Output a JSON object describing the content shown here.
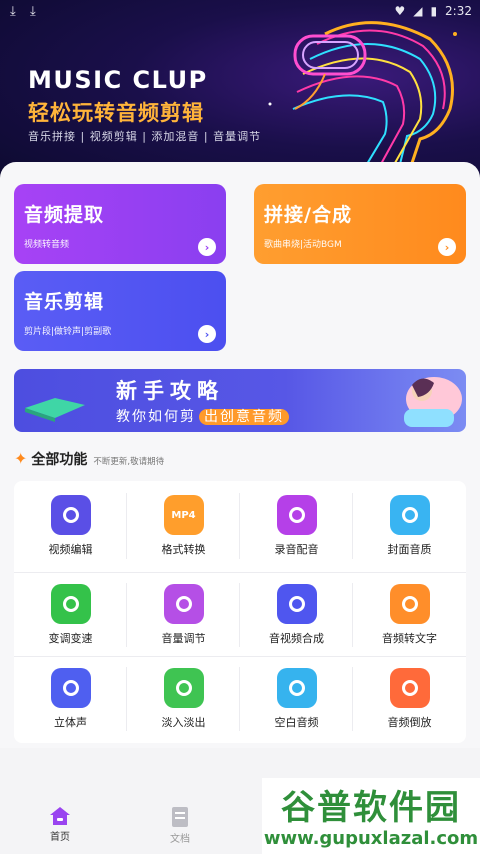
{
  "status": {
    "time": "2:32"
  },
  "banner": {
    "title": "MUSIC CLUP",
    "subtitle": "轻松玩转音频剪辑",
    "tags": "音乐拼接 | 视频剪辑 | 添加混音 | 音量调节"
  },
  "cards": [
    {
      "title": "音频提取",
      "desc": "视频转音频"
    },
    {
      "title": "拼接/合成",
      "desc": "歌曲串烧|活动BGM"
    },
    {
      "title": "音乐剪辑",
      "desc": "剪片段|做铃声|剪副歌"
    }
  ],
  "promo": {
    "title": "新手攻略",
    "sub_prefix": "教你如何剪",
    "sub_highlight": "出创意音频"
  },
  "section": {
    "title": "全部功能",
    "subtitle": "不断更新,敬请期待"
  },
  "features": [
    {
      "label": "视频编辑",
      "icon": "video-edit-icon",
      "color": "#5a4fe6"
    },
    {
      "label": "格式转换",
      "icon": "mp4-format-icon",
      "color": "#ff9e2c",
      "text": "MP4"
    },
    {
      "label": "录音配音",
      "icon": "record-icon",
      "color": "#b540e8"
    },
    {
      "label": "封面音质",
      "icon": "cover-image-icon",
      "color": "#39b4f2"
    },
    {
      "label": "变调变速",
      "icon": "speed-icon",
      "color": "#34c24a"
    },
    {
      "label": "音量调节",
      "icon": "volume-icon",
      "color": "#b54fe6"
    },
    {
      "label": "音视频合成",
      "icon": "av-merge-icon",
      "color": "#4f56ef"
    },
    {
      "label": "音频转文字",
      "icon": "audio-to-text-icon",
      "color": "#ff8e2a"
    },
    {
      "label": "立体声",
      "icon": "stereo-icon",
      "color": "#4f5ff0"
    },
    {
      "label": "淡入淡出",
      "icon": "fade-icon",
      "color": "#3fc452"
    },
    {
      "label": "空白音频",
      "icon": "blank-audio-icon",
      "color": "#36b3ee"
    },
    {
      "label": "音频倒放",
      "icon": "reverse-icon",
      "color": "#ff6a3a"
    }
  ],
  "nav": {
    "home": "首页",
    "docs": "文档"
  },
  "watermark": {
    "text": "谷普软件园",
    "url": "www.gupuxlazal.com"
  }
}
